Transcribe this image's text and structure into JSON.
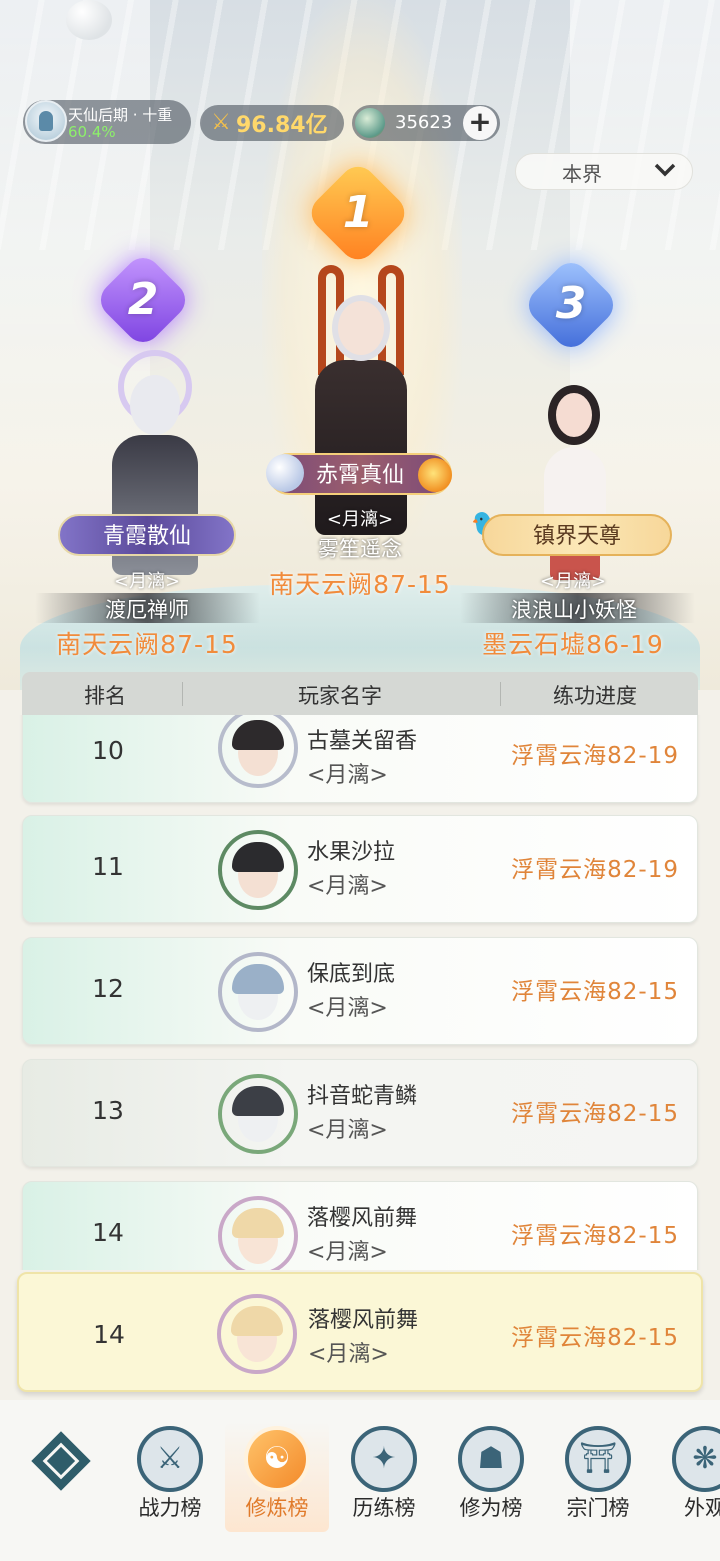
{
  "status_bar": {
    "realm_title": "天仙后期 · 十重",
    "realm_progress": "60.4%",
    "power_value": "96.84亿",
    "coin_value": "35623",
    "plus_icon": "plus-icon"
  },
  "scope_select": {
    "value": "本界",
    "icon": "chevron-down-icon"
  },
  "podium": [
    {
      "rank": "1",
      "title": "赤霄真仙",
      "guild": "<月漓>",
      "player": "雾笙遥念",
      "level": "南天云阙87-15"
    },
    {
      "rank": "2",
      "title": "青霞散仙",
      "guild": "<月漓>",
      "player": "渡厄禅师",
      "level": "南天云阙87-15"
    },
    {
      "rank": "3",
      "title": "镇界天尊",
      "guild": "<月漓>",
      "player": "浪浪山小妖怪",
      "level": "墨云石墟86-19"
    }
  ],
  "table": {
    "headers": [
      "排名",
      "玩家名字",
      "练功进度"
    ],
    "rows": [
      {
        "rank": "10",
        "name": "古墓关留香",
        "guild": "<月漓>",
        "level": "浮霄云海82-19"
      },
      {
        "rank": "11",
        "name": "水果沙拉",
        "guild": "<月漓>",
        "level": "浮霄云海82-19"
      },
      {
        "rank": "12",
        "name": "保底到底",
        "guild": "<月漓>",
        "level": "浮霄云海82-15"
      },
      {
        "rank": "13",
        "name": "抖音蛇青鳞",
        "guild": "<月漓>",
        "level": "浮霄云海82-15"
      },
      {
        "rank": "14",
        "name": "落樱风前舞",
        "guild": "<月漓>",
        "level": "浮霄云海82-15"
      }
    ]
  },
  "self_row": {
    "rank": "14",
    "name": "落樱风前舞",
    "guild": "<月漓>",
    "level": "浮霄云海82-15"
  },
  "bottom_nav": {
    "items": [
      {
        "label": "战力榜",
        "icon": "swords-icon"
      },
      {
        "label": "修炼榜",
        "icon": "yin-yang-icon"
      },
      {
        "label": "历练榜",
        "icon": "star-icon"
      },
      {
        "label": "修为榜",
        "icon": "hat-icon"
      },
      {
        "label": "宗门榜",
        "icon": "gate-icon"
      },
      {
        "label": "外观",
        "icon": "wings-icon"
      }
    ],
    "active_index": 1
  },
  "colors": {
    "accent_orange": "#e0853a",
    "rank1": "#ff9a2e",
    "rank2": "#9a5cf0",
    "rank3": "#4f7ee6",
    "nav_icon": "#3b6478"
  }
}
